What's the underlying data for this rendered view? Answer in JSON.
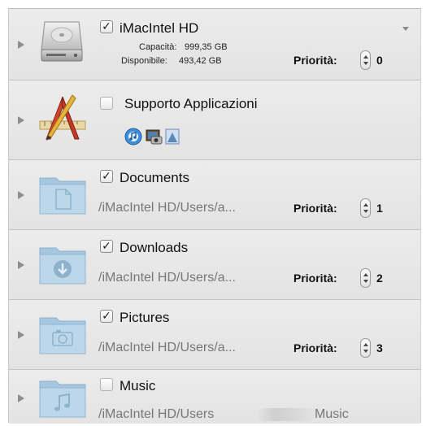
{
  "rows": [
    {
      "name": "iMacIntel HD",
      "checked": true,
      "capacity_label": "Capacità:",
      "capacity_value": "999,35 GB",
      "available_label": "Disponibile:",
      "available_value": "493,42 GB",
      "priority_label": "Priorità:",
      "priority_value": "0"
    },
    {
      "name": "Supporto Applicazioni",
      "checked": false
    },
    {
      "name": "Documents",
      "checked": true,
      "path": "/iMacIntel HD/Users/a...",
      "priority_label": "Priorità:",
      "priority_value": "1"
    },
    {
      "name": "Downloads",
      "checked": true,
      "path": "/iMacIntel HD/Users/a...",
      "priority_label": "Priorità:",
      "priority_value": "2"
    },
    {
      "name": "Pictures",
      "checked": true,
      "path": "/iMacIntel HD/Users/a...",
      "priority_label": "Priorità:",
      "priority_value": "3"
    },
    {
      "name": "Music",
      "checked": false,
      "path_prefix": "/iMacIntel HD/Users",
      "path_suffix": "Music"
    }
  ],
  "checkmark": "✓",
  "icons": {
    "hard-drive": "hard-drive-icon",
    "app-support": "app-support-icon",
    "documents": "documents-folder-icon",
    "downloads": "downloads-folder-icon",
    "pictures": "pictures-folder-icon",
    "music": "music-folder-icon"
  }
}
